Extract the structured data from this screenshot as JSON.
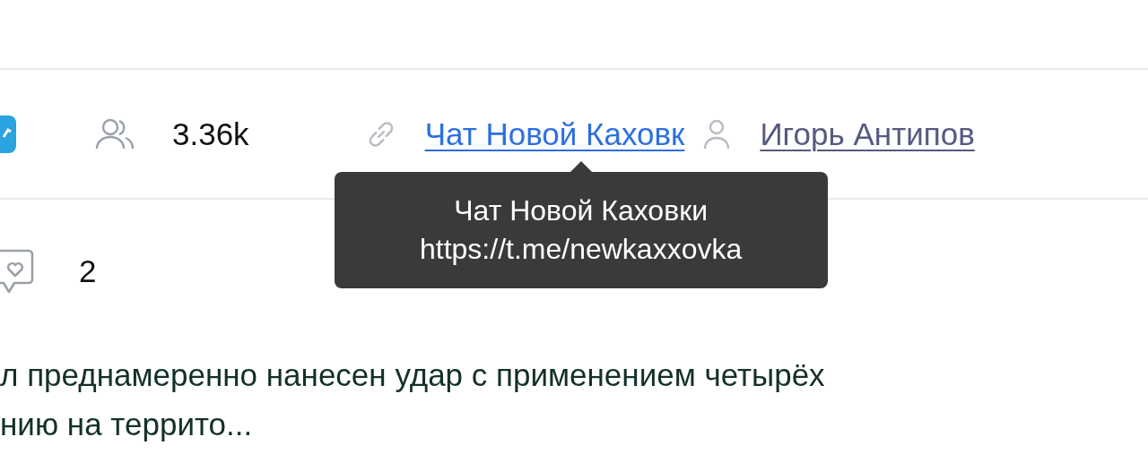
{
  "stats": {
    "members": "3.36k",
    "link": {
      "label": "Чат Новой Каховк",
      "tooltip_title": "Чат Новой Каховки",
      "tooltip_url": "https://t.me/newkaxxovka",
      "tooltip_shown": true
    },
    "owner": "Игорь Антипов"
  },
  "reactions": {
    "count": "2"
  },
  "post": {
    "lines": [
      "л преднамеренно нанесен удар с применением четырёх",
      "нию на террито..."
    ]
  }
}
